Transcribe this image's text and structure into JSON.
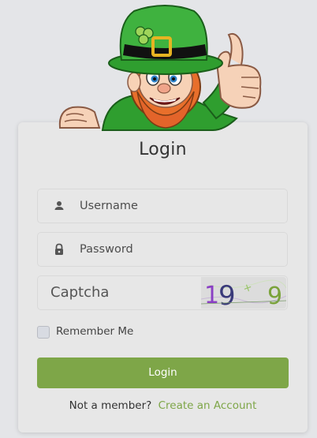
{
  "form": {
    "title": "Login",
    "username_placeholder": "Username",
    "password_placeholder": "Password",
    "captcha_placeholder": "Captcha",
    "captcha_code": "19 9",
    "remember_label": "Remember Me",
    "login_label": "Login",
    "signup_prompt": "Not a member?",
    "signup_link": "Create an Account"
  },
  "icons": {
    "username": "user-icon",
    "password": "lock-icon",
    "mascot": "leprechaun-mascot"
  },
  "colors": {
    "accent": "#7ea648",
    "background": "#e4e5e8",
    "card": "#e7e7e7"
  }
}
